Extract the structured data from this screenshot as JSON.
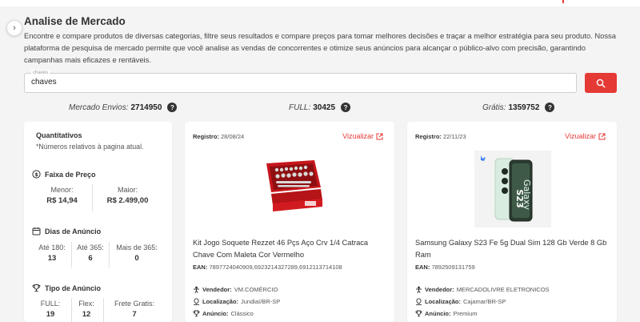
{
  "header": {
    "title": "Analise de Mercado",
    "description": "Encontre e compare produtos de diversas categorias, filtre seus resultados e compare preços para tomar melhores decisões e traçar a melhor estratégia para seu produto. Nossa plataforma de pesquisa de mercado permite que você analise as vendas de concorrentes e otimize seus anúncios para alcançar o público-alvo com precisão, garantindo campanhas mais eficazes e rentáveis."
  },
  "search": {
    "legend": "chaves",
    "value": "chaves"
  },
  "stats": [
    {
      "label": "Mercado Envios:",
      "value": "2714950"
    },
    {
      "label": "FULL:",
      "value": "30425"
    },
    {
      "label": "Grátis:",
      "value": "1359752"
    }
  ],
  "quantitativos": {
    "title": "Quantitativos",
    "note": "*Números relativos à pagina atual.",
    "faixa": {
      "title": "Faixa de Preço",
      "menor_label": "Menor:",
      "menor_value": "R$ 14,94",
      "maior_label": "Maior:",
      "maior_value": "R$ 2.499,00"
    },
    "dias": {
      "title": "Dias de Anúncio",
      "a_label": "Até 180:",
      "a_value": "13",
      "b_label": "Até 365:",
      "b_value": "6",
      "c_label": "Mais de 365:",
      "c_value": "0"
    },
    "tipo": {
      "title": "Tipo de Anúncio",
      "a_label": "FULL:",
      "a_value": "19",
      "b_label": "Flex:",
      "b_value": "12",
      "c_label": "Frete Gratis:",
      "c_value": "7"
    }
  },
  "products": [
    {
      "registro_label": "Registro:",
      "registro_date": "28/08/24",
      "view_label": "Vizualizar",
      "name": "Kit Jogo Soquete Rezzet 46 Pçs Aço Crv 1/4 Catraca Chave Com Maleta Cor Vermelho",
      "ean_label": "EAN:",
      "ean": "7897724040909,6923214327289,6912113714108",
      "vendedor_label": "Vendedor:",
      "vendedor": "VM.COMÉRCIO",
      "localizacao_label": "Localização:",
      "localizacao": "Jundiaí/BR-SP",
      "anuncio_label": "Anúncio:",
      "anuncio": "Clássico"
    },
    {
      "registro_label": "Registro:",
      "registro_date": "22/11/23",
      "view_label": "Vizualizar",
      "name": "Samsung Galaxy S23 Fe 5g Dual Sim 128 Gb Verde 8 Gb Ram",
      "ean_label": "EAN:",
      "ean": "7892509131759",
      "vendedor_label": "Vendedor:",
      "vendedor": "MERCADOLIVRE ELETRONICOS",
      "localizacao_label": "Localização:",
      "localizacao": "Cajamar/BR-SP",
      "anuncio_label": "Anúncio:",
      "anuncio": "Premium"
    }
  ],
  "colors": {
    "accent": "#e53935",
    "background": "#f4f4f5"
  }
}
